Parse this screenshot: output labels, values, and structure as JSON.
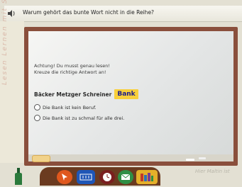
{
  "question": {
    "text": "Warum gehört das bunte Wort nicht in die Reihe?"
  },
  "instructions": {
    "line1": "Achtung! Du musst genau lesen!",
    "line2": "Kreuze die richtige Antwort an!"
  },
  "words_row": {
    "plain": "Bäcker Metzger Schreiner",
    "highlighted": "Bank"
  },
  "options": [
    {
      "label": "Die Bank ist kein Beruf."
    },
    {
      "label": "Die Bank ist zu schmal für alle drei."
    }
  ],
  "decor": {
    "handwriting": "Lesen Lernen mit Spaß",
    "corner_note": "Hier Maltin ist"
  },
  "colors": {
    "frame": "#8a4f3c",
    "highlight": "#f8cf3a",
    "highlight_text": "#1d1d8a"
  },
  "icons": [
    "speaker-icon",
    "cursor-button",
    "numbers-button",
    "clock-button",
    "mail-button",
    "books-button",
    "bottle-icon"
  ]
}
